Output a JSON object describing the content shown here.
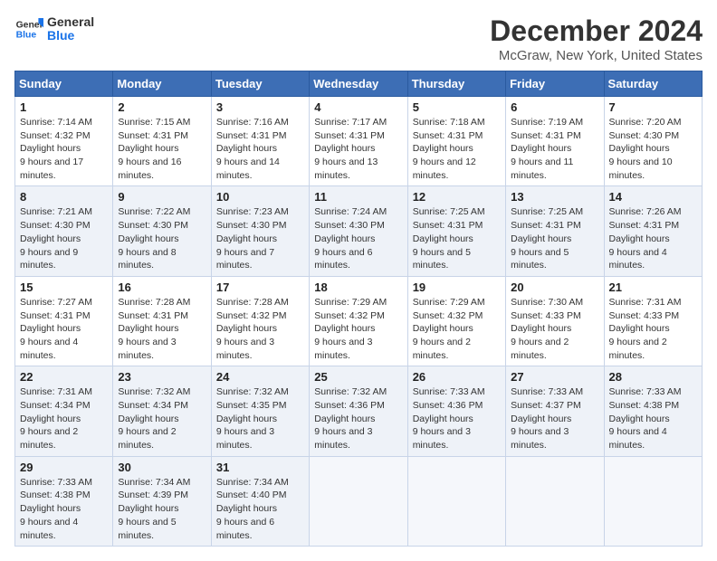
{
  "header": {
    "logo_line1": "General",
    "logo_line2": "Blue",
    "month": "December 2024",
    "location": "McGraw, New York, United States"
  },
  "weekdays": [
    "Sunday",
    "Monday",
    "Tuesday",
    "Wednesday",
    "Thursday",
    "Friday",
    "Saturday"
  ],
  "weeks": [
    [
      {
        "day": "1",
        "sunrise": "7:14 AM",
        "sunset": "4:32 PM",
        "daylight": "9 hours and 17 minutes."
      },
      {
        "day": "2",
        "sunrise": "7:15 AM",
        "sunset": "4:31 PM",
        "daylight": "9 hours and 16 minutes."
      },
      {
        "day": "3",
        "sunrise": "7:16 AM",
        "sunset": "4:31 PM",
        "daylight": "9 hours and 14 minutes."
      },
      {
        "day": "4",
        "sunrise": "7:17 AM",
        "sunset": "4:31 PM",
        "daylight": "9 hours and 13 minutes."
      },
      {
        "day": "5",
        "sunrise": "7:18 AM",
        "sunset": "4:31 PM",
        "daylight": "9 hours and 12 minutes."
      },
      {
        "day": "6",
        "sunrise": "7:19 AM",
        "sunset": "4:31 PM",
        "daylight": "9 hours and 11 minutes."
      },
      {
        "day": "7",
        "sunrise": "7:20 AM",
        "sunset": "4:30 PM",
        "daylight": "9 hours and 10 minutes."
      }
    ],
    [
      {
        "day": "8",
        "sunrise": "7:21 AM",
        "sunset": "4:30 PM",
        "daylight": "9 hours and 9 minutes."
      },
      {
        "day": "9",
        "sunrise": "7:22 AM",
        "sunset": "4:30 PM",
        "daylight": "9 hours and 8 minutes."
      },
      {
        "day": "10",
        "sunrise": "7:23 AM",
        "sunset": "4:30 PM",
        "daylight": "9 hours and 7 minutes."
      },
      {
        "day": "11",
        "sunrise": "7:24 AM",
        "sunset": "4:30 PM",
        "daylight": "9 hours and 6 minutes."
      },
      {
        "day": "12",
        "sunrise": "7:25 AM",
        "sunset": "4:31 PM",
        "daylight": "9 hours and 5 minutes."
      },
      {
        "day": "13",
        "sunrise": "7:25 AM",
        "sunset": "4:31 PM",
        "daylight": "9 hours and 5 minutes."
      },
      {
        "day": "14",
        "sunrise": "7:26 AM",
        "sunset": "4:31 PM",
        "daylight": "9 hours and 4 minutes."
      }
    ],
    [
      {
        "day": "15",
        "sunrise": "7:27 AM",
        "sunset": "4:31 PM",
        "daylight": "9 hours and 4 minutes."
      },
      {
        "day": "16",
        "sunrise": "7:28 AM",
        "sunset": "4:31 PM",
        "daylight": "9 hours and 3 minutes."
      },
      {
        "day": "17",
        "sunrise": "7:28 AM",
        "sunset": "4:32 PM",
        "daylight": "9 hours and 3 minutes."
      },
      {
        "day": "18",
        "sunrise": "7:29 AM",
        "sunset": "4:32 PM",
        "daylight": "9 hours and 3 minutes."
      },
      {
        "day": "19",
        "sunrise": "7:29 AM",
        "sunset": "4:32 PM",
        "daylight": "9 hours and 2 minutes."
      },
      {
        "day": "20",
        "sunrise": "7:30 AM",
        "sunset": "4:33 PM",
        "daylight": "9 hours and 2 minutes."
      },
      {
        "day": "21",
        "sunrise": "7:31 AM",
        "sunset": "4:33 PM",
        "daylight": "9 hours and 2 minutes."
      }
    ],
    [
      {
        "day": "22",
        "sunrise": "7:31 AM",
        "sunset": "4:34 PM",
        "daylight": "9 hours and 2 minutes."
      },
      {
        "day": "23",
        "sunrise": "7:32 AM",
        "sunset": "4:34 PM",
        "daylight": "9 hours and 2 minutes."
      },
      {
        "day": "24",
        "sunrise": "7:32 AM",
        "sunset": "4:35 PM",
        "daylight": "9 hours and 3 minutes."
      },
      {
        "day": "25",
        "sunrise": "7:32 AM",
        "sunset": "4:36 PM",
        "daylight": "9 hours and 3 minutes."
      },
      {
        "day": "26",
        "sunrise": "7:33 AM",
        "sunset": "4:36 PM",
        "daylight": "9 hours and 3 minutes."
      },
      {
        "day": "27",
        "sunrise": "7:33 AM",
        "sunset": "4:37 PM",
        "daylight": "9 hours and 3 minutes."
      },
      {
        "day": "28",
        "sunrise": "7:33 AM",
        "sunset": "4:38 PM",
        "daylight": "9 hours and 4 minutes."
      }
    ],
    [
      {
        "day": "29",
        "sunrise": "7:33 AM",
        "sunset": "4:38 PM",
        "daylight": "9 hours and 4 minutes."
      },
      {
        "day": "30",
        "sunrise": "7:34 AM",
        "sunset": "4:39 PM",
        "daylight": "9 hours and 5 minutes."
      },
      {
        "day": "31",
        "sunrise": "7:34 AM",
        "sunset": "4:40 PM",
        "daylight": "9 hours and 6 minutes."
      },
      null,
      null,
      null,
      null
    ]
  ],
  "labels": {
    "sunrise": "Sunrise:",
    "sunset": "Sunset:",
    "daylight": "Daylight hours"
  }
}
